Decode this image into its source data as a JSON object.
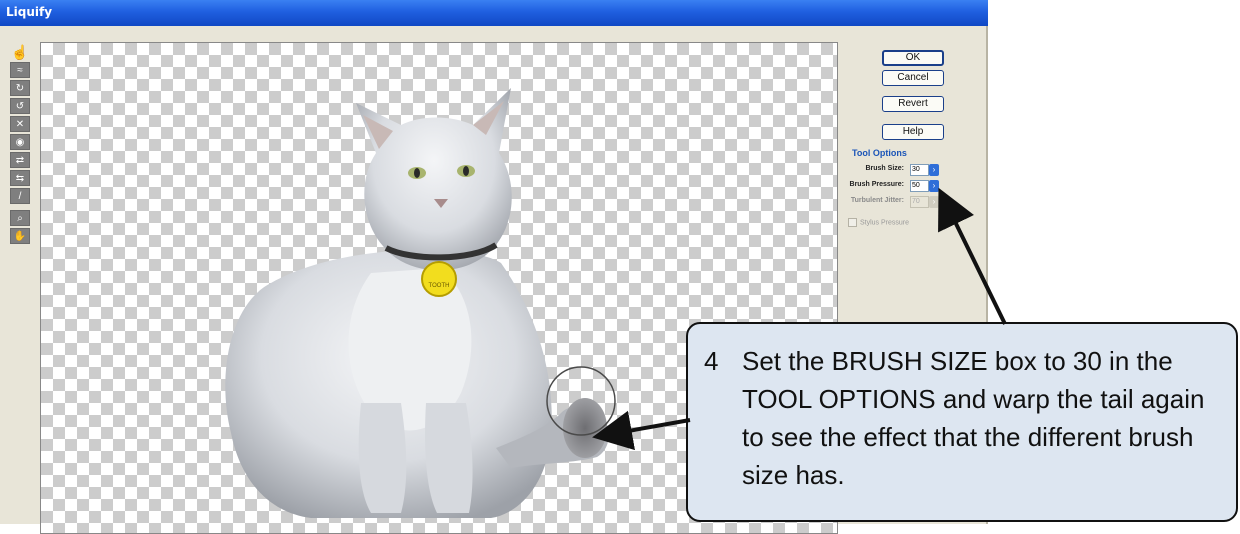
{
  "window": {
    "title": "Liquify"
  },
  "toolbar": {
    "tools": [
      {
        "icon": "warp-tool-icon"
      },
      {
        "icon": "turbulence-tool-icon"
      },
      {
        "icon": "twirl-clockwise-icon"
      },
      {
        "icon": "twirl-counterclockwise-icon"
      },
      {
        "icon": "pucker-icon"
      },
      {
        "icon": "bloat-icon"
      },
      {
        "icon": "shift-pixels-icon"
      },
      {
        "icon": "reflection-icon"
      },
      {
        "icon": "reconstruct-icon"
      },
      {
        "icon": "zoom-icon"
      },
      {
        "icon": "hand-icon"
      }
    ]
  },
  "buttons": {
    "ok": "OK",
    "cancel": "Cancel",
    "revert": "Revert",
    "help": "Help"
  },
  "tool_options": {
    "heading": "Tool Options",
    "brush_size_label": "Brush Size:",
    "brush_size_value": "30",
    "brush_pressure_label": "Brush Pressure:",
    "brush_pressure_value": "50",
    "turbulent_jitter_label": "Turbulent Jitter:",
    "turbulent_jitter_value": "70",
    "stylus_pressure_label": "Stylus Pressure"
  },
  "collar_tag_text": "TOOTH",
  "callout": {
    "number": "4",
    "text": "Set the BRUSH SIZE box to 30 in the TOOL OPTIONS and warp the tail again to see the effect that the different brush size has."
  }
}
